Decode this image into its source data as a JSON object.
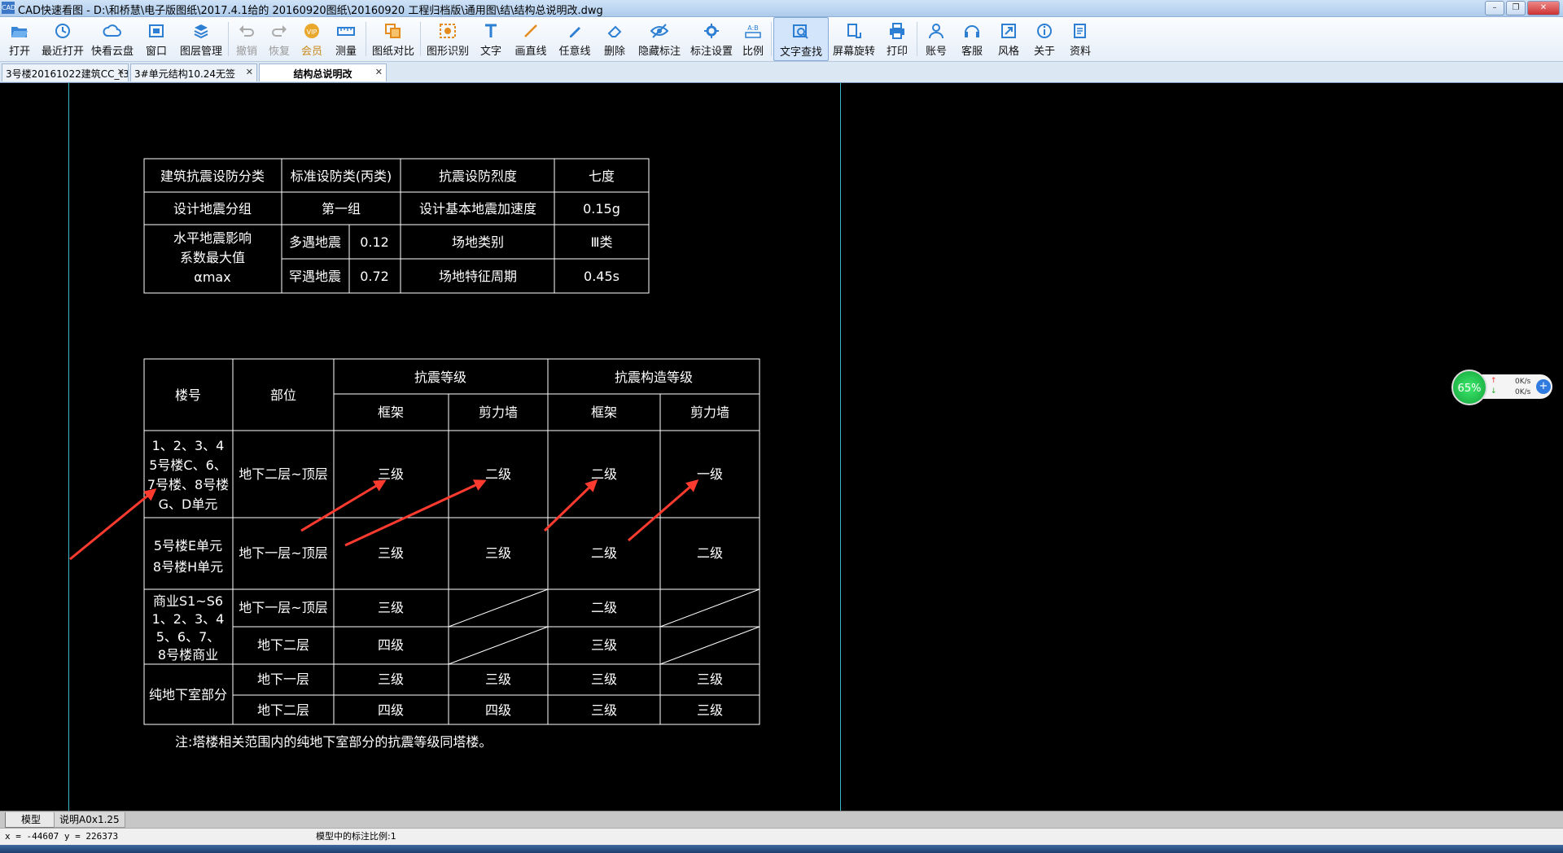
{
  "window": {
    "app_icon": "CAD",
    "title": "CAD快速看图 - D:\\和桥慧\\电子版图纸\\2017.4.1给的 20160920图纸\\20160920 工程归档版\\通用图\\结\\结构总说明改.dwg",
    "min": "–",
    "max": "❐",
    "close": "✕"
  },
  "toolbar": [
    {
      "id": "open",
      "label": "打开",
      "icon": "folder-open-icon"
    },
    {
      "id": "recent",
      "label": "最近打开",
      "icon": "clock-icon"
    },
    {
      "id": "cloud",
      "label": "快看云盘",
      "icon": "cloud-icon"
    },
    {
      "id": "window",
      "label": "窗口",
      "icon": "window-icon"
    },
    {
      "id": "layers",
      "label": "图层管理",
      "icon": "layers-icon"
    },
    {
      "id": "undo",
      "label": "撤销",
      "icon": "undo-icon",
      "disabled": true
    },
    {
      "id": "redo",
      "label": "恢复",
      "icon": "redo-icon",
      "disabled": true
    },
    {
      "id": "vip",
      "label": "会员",
      "icon": "vip-icon"
    },
    {
      "id": "measure",
      "label": "测量",
      "icon": "ruler-icon"
    },
    {
      "id": "compare",
      "label": "图纸对比",
      "icon": "compare-icon"
    },
    {
      "id": "recognize",
      "label": "图形识别",
      "icon": "shape-recognize-icon"
    },
    {
      "id": "text",
      "label": "文字",
      "icon": "text-icon"
    },
    {
      "id": "line",
      "label": "画直线",
      "icon": "line-icon"
    },
    {
      "id": "freeline",
      "label": "任意线",
      "icon": "pen-icon"
    },
    {
      "id": "delete",
      "label": "删除",
      "icon": "eraser-icon"
    },
    {
      "id": "hide",
      "label": "隐藏标注",
      "icon": "eye-hide-icon"
    },
    {
      "id": "markset",
      "label": "标注设置",
      "icon": "mark-settings-icon"
    },
    {
      "id": "scale",
      "label": "比例",
      "icon": "scale-icon"
    },
    {
      "id": "findtext",
      "label": "文字查找",
      "icon": "text-search-icon",
      "active": true
    },
    {
      "id": "rotate",
      "label": "屏幕旋转",
      "icon": "rotate-screen-icon"
    },
    {
      "id": "print",
      "label": "打印",
      "icon": "printer-icon"
    },
    {
      "id": "account",
      "label": "账号",
      "icon": "user-icon"
    },
    {
      "id": "service",
      "label": "客服",
      "icon": "headset-icon"
    },
    {
      "id": "style",
      "label": "风格",
      "icon": "style-icon"
    },
    {
      "id": "about",
      "label": "关于",
      "icon": "info-icon"
    },
    {
      "id": "docs",
      "label": "资料",
      "icon": "docs-icon"
    }
  ],
  "tabs": [
    {
      "label": "3号楼20161022建筑CC_t3",
      "close": "✕"
    },
    {
      "label": "3#单元结构10.24无签",
      "close": "✕"
    },
    {
      "label": "结构总说明改",
      "close": "✕",
      "active": true
    }
  ],
  "drawing": {
    "table1": {
      "r1": [
        "建筑抗震设防分类",
        "标准设防类(丙类)",
        "抗震设防烈度",
        "七度"
      ],
      "r2": [
        "设计地震分组",
        "第一组",
        "设计基本地震加速度",
        "0.15g"
      ],
      "merged": [
        "水平地震影响",
        "系数最大值",
        "αmax"
      ],
      "r3": [
        "多遇地震",
        "0.12",
        "场地类别",
        "Ⅲ类"
      ],
      "r4": [
        "罕遇地震",
        "0.72",
        "场地特征周期",
        "0.45s"
      ]
    },
    "table2": {
      "h_building": "楼号",
      "h_part": "部位",
      "h_grade": "抗震等级",
      "h_construct": "抗震构造等级",
      "h_frame": "框架",
      "h_wall": "剪力墙",
      "b1": [
        "1、2、3、4",
        "5号楼C、6、",
        "7号楼、8号楼",
        "G、D单元"
      ],
      "b1_part": "地下二层~顶层",
      "b1_vals": [
        "三级",
        "二级",
        "二级",
        "一级"
      ],
      "b2": [
        "5号楼E单元",
        "8号楼H单元"
      ],
      "b2_part": "地下一层~顶层",
      "b2_vals": [
        "三级",
        "三级",
        "二级",
        "二级"
      ],
      "b3": [
        "商业S1~S6",
        "1、2、3、4",
        "5、6、7、",
        "8号楼商业"
      ],
      "b3_part1": "地下一层~顶层",
      "b3_vals1": [
        "三级",
        "二级"
      ],
      "b3_part2": "地下二层",
      "b3_vals2": [
        "四级",
        "三级"
      ],
      "b4": "纯地下室部分",
      "b4_part1": "地下一层",
      "b4_vals1": [
        "三级",
        "三级",
        "三级",
        "三级"
      ],
      "b4_part2": "地下二层",
      "b4_vals2": [
        "四级",
        "四级",
        "三级",
        "三级"
      ],
      "note": "注:塔楼相关范围内的纯地下室部分的抗震等级同塔楼。"
    }
  },
  "net_widget": {
    "percent": "65%",
    "up": "0K/s",
    "down": "0K/s",
    "up_arrow": "↑",
    "down_arrow": "↓",
    "plus": "+"
  },
  "layout_tabs": {
    "model": "模型",
    "sheet": "说明A0x1.25"
  },
  "status": {
    "coords": "x = -44607  y = 226373",
    "scale": "模型中的标注比例:1"
  },
  "colors": {
    "cad_bg": "#000000",
    "frame_line": "#3bb8c8",
    "arrow": "#ff3b30",
    "cad_text": "#ffffff"
  }
}
